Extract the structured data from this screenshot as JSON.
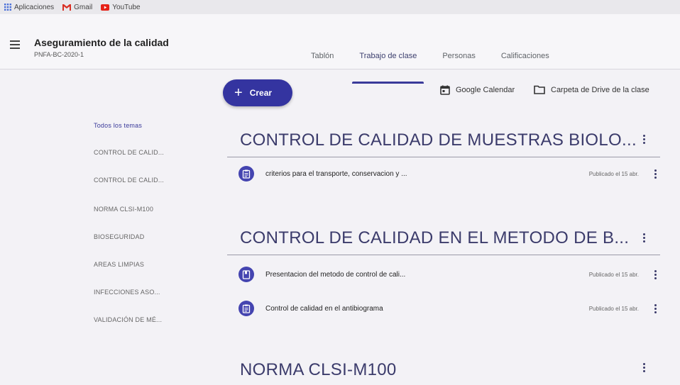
{
  "bookmarks": [
    {
      "label": "Aplicaciones",
      "icon": "apps-grid-icon"
    },
    {
      "label": "Gmail",
      "icon": "gmail-icon"
    },
    {
      "label": "YouTube",
      "icon": "youtube-icon"
    }
  ],
  "header": {
    "title": "Aseguramiento de la calidad",
    "subtitle": "PNFA-BC-2020-1"
  },
  "tabs": [
    {
      "label": "Tablón",
      "active": false
    },
    {
      "label": "Trabajo de clase",
      "active": true
    },
    {
      "label": "Personas",
      "active": false
    },
    {
      "label": "Calificaciones",
      "active": false
    }
  ],
  "toolbar": {
    "create_label": "Crear",
    "calendar_label": "Google Calendar",
    "drive_label": "Carpeta de Drive de la clase"
  },
  "sidebar": {
    "items": [
      {
        "label": "Todos los temas",
        "active": true
      },
      {
        "label": "CONTROL DE CALID..."
      },
      {
        "label": "CONTROL DE CALID..."
      },
      {
        "label": "NORMA CLSI-M100"
      },
      {
        "label": "BIOSEGURIDAD"
      },
      {
        "label": "AREAS LIMPIAS"
      },
      {
        "label": "INFECCIONES ASO..."
      },
      {
        "label": "VALIDACIÓN DE MÉ..."
      }
    ]
  },
  "topics": [
    {
      "title": "CONTROL DE CALIDAD DE MUESTRAS BIOLO...",
      "items": [
        {
          "title": "criterios para el transporte, conservacion y ...",
          "date": "Publicado el 15 abr.",
          "icon": "assignment-icon"
        }
      ]
    },
    {
      "title": "CONTROL DE CALIDAD EN EL METODO DE B...",
      "items": [
        {
          "title": "Presentacion del metodo de control de cali...",
          "date": "Publicado el 15 abr.",
          "icon": "material-icon"
        },
        {
          "title": "Control de calidad en el antibiograma",
          "date": "Publicado el 15 abr.",
          "icon": "assignment-icon"
        }
      ]
    },
    {
      "title": "NORMA CLSI-M100",
      "items": []
    }
  ],
  "colors": {
    "accent": "#3434a0",
    "background": "#f3f2f6",
    "topic_text": "#3b3b6b"
  }
}
